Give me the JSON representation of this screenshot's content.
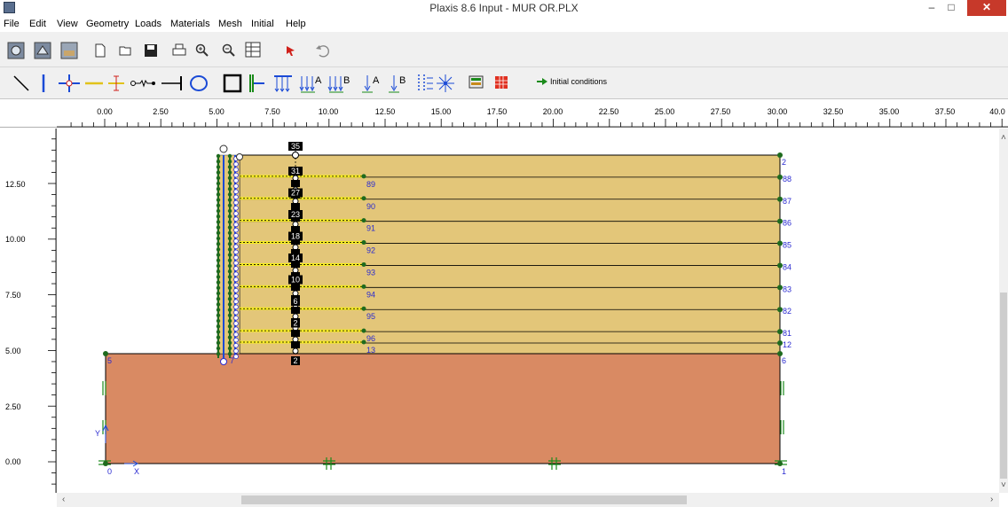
{
  "window": {
    "title": "Plaxis 8.6 Input - MUR OR.PLX",
    "minimize": "–",
    "maximize": "□",
    "close": "✕"
  },
  "menu": [
    "File",
    "Edit",
    "View",
    "Geometry",
    "Loads",
    "Materials",
    "Mesh",
    "Initial",
    "Help"
  ],
  "toolbar1_icons": [
    "general-settings-icon",
    "open-project-icon",
    "soil-icon",
    "new-icon",
    "open-icon",
    "save-icon",
    "print-icon",
    "zoom-in-icon",
    "zoom-out-icon",
    "table-icon",
    "selection-arrow-icon",
    "undo-icon"
  ],
  "toolbar2_icons": [
    "geometry-line-icon",
    "plate-icon",
    "hinge-icon",
    "geogrid-icon",
    "node-to-node-anchor-icon",
    "fixed-end-anchor-icon",
    "tunnel-icon",
    "standard-fixities-icon",
    "horizontal-fixity-icon",
    "prescribed-displacement-icon",
    "load-system-a-icon",
    "load-system-b-icon",
    "point-load-a-icon",
    "point-load-b-icon",
    "drain-icon",
    "well-icon",
    "materials-icon",
    "mesh-icon"
  ],
  "initial_conditions_label": "Initial conditions",
  "ruler": {
    "x_ticks": [
      "0.00",
      "2.50",
      "5.00",
      "7.50",
      "10.00",
      "12.50",
      "15.00",
      "17.50",
      "20.00",
      "22.50",
      "25.00",
      "27.50",
      "30.00",
      "32.50",
      "35.00",
      "37.50",
      "40.0"
    ],
    "y_ticks": [
      "12.50",
      "10.00",
      "7.50",
      "5.00",
      "2.50",
      "0.00"
    ]
  },
  "colors": {
    "foundation_soil": "#d98a63",
    "backfill_soil": "#e3c679",
    "geogrid": "#f5ea22",
    "point": "#1e6b1e",
    "label": "#2a2ad0",
    "window_close": "#c7392a"
  },
  "model": {
    "axis_x_label": "X",
    "axis_y_label": "Y",
    "foundation_labels": {
      "top_left": "5",
      "top_right": "6",
      "bottom_left": "0",
      "bottom_right": "1"
    },
    "wall_bottom_label": "7",
    "column_bottom_label": "2",
    "column_top_label": "35",
    "column_labels": [
      "31",
      "27",
      "23",
      "18",
      "14",
      "10",
      "6",
      "2"
    ],
    "layer_labels_mid": [
      "89",
      "90",
      "91",
      "92",
      "93",
      "94",
      "95",
      "96",
      "13"
    ],
    "layer_labels_right": [
      "88",
      "87",
      "86",
      "85",
      "84",
      "83",
      "82",
      "81",
      "12"
    ],
    "top_right_label": "2"
  }
}
